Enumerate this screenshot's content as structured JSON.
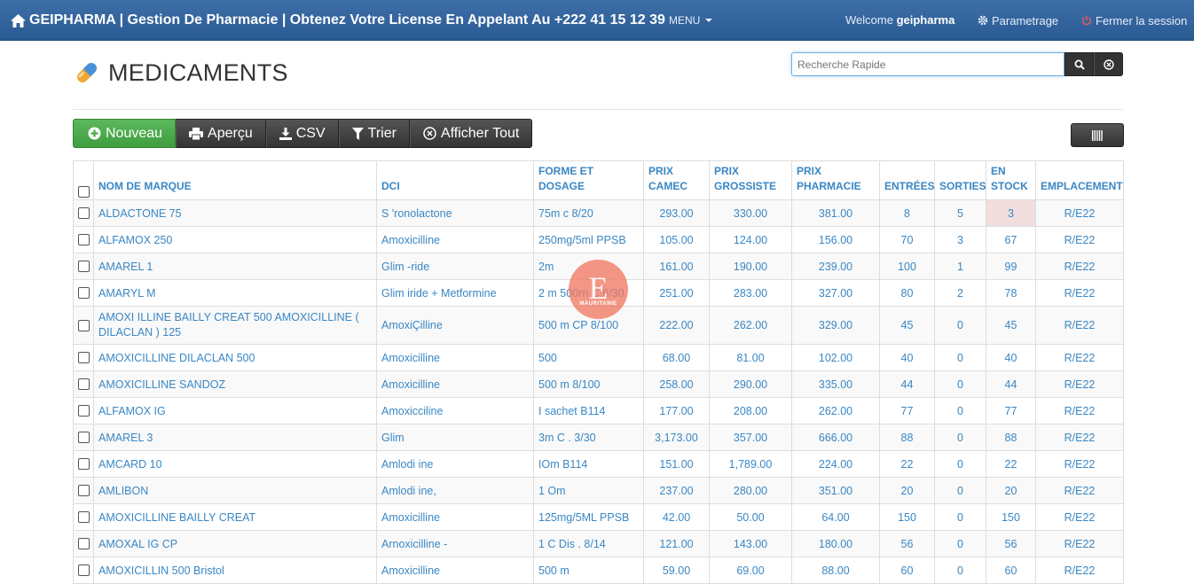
{
  "navbar": {
    "brand": "GEIPHARMA | Gestion De Pharmacie | Obtenez Votre License En Appelant Au +222 41 15 12 39",
    "menu_label": "MENU",
    "welcome_prefix": "Welcome",
    "welcome_user": "geipharma",
    "settings_label": "Parametrage",
    "logout_label": "Fermer la session"
  },
  "header": {
    "title": "MEDICAMENTS"
  },
  "search": {
    "placeholder": "Recherche Rapide"
  },
  "toolbar": {
    "new_label": "Nouveau",
    "preview_label": "Aperçu",
    "csv_label": "CSV",
    "sort_label": "Trier",
    "show_all_label": "Afficher Tout"
  },
  "watermark": {
    "letter": "E",
    "text": "MAURITANIE"
  },
  "table": {
    "columns": [
      "NOM DE MARQUE",
      "DCI",
      "FORME ET DOSAGE",
      "PRIX CAMEC",
      "PRIX GROSSISTE",
      "PRIX PHARMACIE",
      "ENTRÉES",
      "SORTIES",
      "EN STOCK",
      "EMPLACEMENT"
    ],
    "rows": [
      [
        "ALDACTONE 75",
        "S 'ronolactone",
        "75m c 8/20",
        "293.00",
        "330.00",
        "381.00",
        "8",
        "5",
        "3",
        "R/E22"
      ],
      [
        "ALFAMOX 250",
        "Amoxicilline",
        "250mg/5ml PPSB",
        "105.00",
        "124.00",
        "156.00",
        "70",
        "3",
        "67",
        "R/E22"
      ],
      [
        "AMAREL 1",
        "Glim -ride",
        "2m",
        "161.00",
        "190.00",
        "239.00",
        "100",
        "1",
        "99",
        "R/E22"
      ],
      [
        "AMARYL M",
        "Glim iride + Metformine",
        "2 m 500rn C 8/30",
        "251.00",
        "283.00",
        "327.00",
        "80",
        "2",
        "78",
        "R/E22"
      ],
      [
        "AMOXI ILLINE BAILLY CREAT 500 AMOXICILLINE ( DILACLAN ) 125",
        "AmoxiÇilline",
        "500 m CP 8/100",
        "222.00",
        "262.00",
        "329.00",
        "45",
        "0",
        "45",
        "R/E22"
      ],
      [
        "AMOXICILLINE DILACLAN 500",
        "Amoxicilline",
        "500",
        "68.00",
        "81.00",
        "102.00",
        "40",
        "0",
        "40",
        "R/E22"
      ],
      [
        "AMOXICILLINE SANDOZ",
        "Amoxicilline",
        "500 m 8/100",
        "258.00",
        "290.00",
        "335.00",
        "44",
        "0",
        "44",
        "R/E22"
      ],
      [
        "ALFAMOX IG",
        "Amoxicciline",
        "I sachet B114",
        "177.00",
        "208.00",
        "262.00",
        "77",
        "0",
        "77",
        "R/E22"
      ],
      [
        "AMAREL 3",
        "Glim",
        "3m C . 3/30",
        "3,173.00",
        "357.00",
        "666.00",
        "88",
        "0",
        "88",
        "R/E22"
      ],
      [
        "AMCARD 10",
        "Amlodi ine",
        "IOm B114",
        "151.00",
        "1,789.00",
        "224.00",
        "22",
        "0",
        "22",
        "R/E22"
      ],
      [
        "AMLIBON",
        "Amlodi ine,",
        "1 Om",
        "237.00",
        "280.00",
        "351.00",
        "20",
        "0",
        "20",
        "R/E22"
      ],
      [
        "AMOXICILLINE BAILLY CREAT",
        "Amoxicilline",
        "125mg/5ML PPSB",
        "42.00",
        "50.00",
        "64.00",
        "150",
        "0",
        "150",
        "R/E22"
      ],
      [
        "AMOXAL IG CP",
        "Arnoxicilline -",
        "1 C Dis . 8/14",
        "121.00",
        "143.00",
        "180.00",
        "56",
        "0",
        "56",
        "R/E22"
      ],
      [
        "AMOXICILLIN 500 Bristol",
        "Amoxicilline",
        "500 m",
        "59.00",
        "69.00",
        "88.00",
        "60",
        "0",
        "60",
        "R/E22"
      ]
    ]
  }
}
